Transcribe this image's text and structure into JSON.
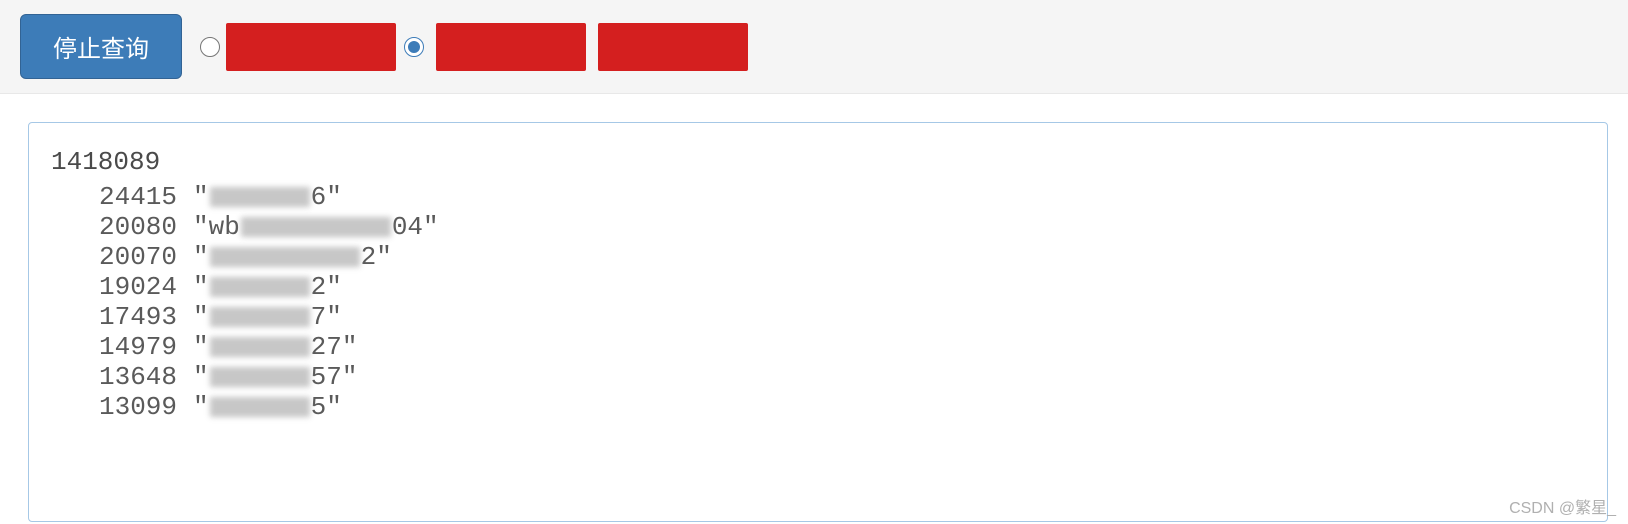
{
  "toolbar": {
    "stop_query_label": "停止查询",
    "radio_options": [
      {
        "checked": false,
        "redacted": true
      },
      {
        "checked": true,
        "redacted": true
      }
    ]
  },
  "output": {
    "total": "1418089",
    "rows": [
      {
        "count": "24415",
        "prefix": "",
        "suffix": "6",
        "mask_class": "w80"
      },
      {
        "count": "20080",
        "prefix": "wb",
        "suffix": "04",
        "mask_class": "w130"
      },
      {
        "count": "20070",
        "prefix": "",
        "suffix": "2",
        "mask_class": "w130"
      },
      {
        "count": "19024",
        "prefix": "",
        "suffix": "2",
        "mask_class": "w90"
      },
      {
        "count": "17493",
        "prefix": "",
        "suffix": "7",
        "mask_class": "w90"
      },
      {
        "count": "14979",
        "prefix": "",
        "suffix": "27",
        "mask_class": "w90"
      },
      {
        "count": "13648",
        "prefix": "",
        "suffix": "57",
        "mask_class": "w90"
      },
      {
        "count": "13099",
        "prefix": "",
        "suffix": "5",
        "mask_class": "w90"
      }
    ]
  },
  "watermark": "CSDN @繁星_"
}
